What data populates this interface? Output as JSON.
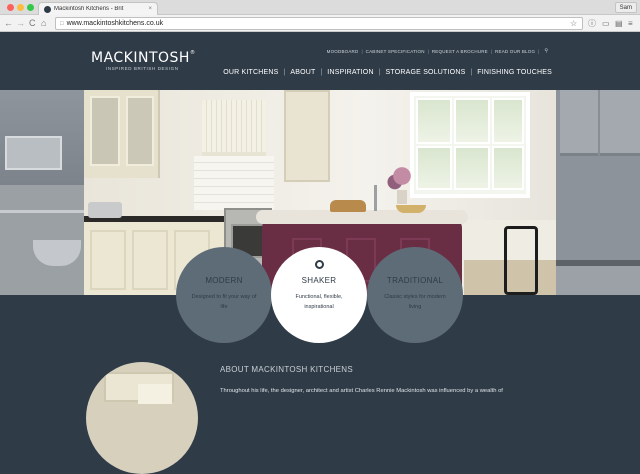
{
  "browser": {
    "tab_title": "Mackintosh Kitchens - Brit",
    "tab_close": "×",
    "user": "Sam",
    "url": "www.mackintoshkitchens.co.uk",
    "back": "←",
    "forward": "→",
    "reload": "C",
    "home": "⌂"
  },
  "header": {
    "logo": "MACKINTOSH",
    "logo_reg": "®",
    "tagline": "INSPIRED BRITISH DESIGN",
    "util_links": [
      "MOODBOARD",
      "CABINET SPECIFICATION",
      "REQUEST A BROCHURE",
      "READ OUR BLOG"
    ],
    "main_links": [
      "OUR KITCHENS",
      "ABOUT",
      "INSPIRATION",
      "STORAGE SOLUTIONS",
      "FINISHING TOUCHES"
    ]
  },
  "styles": [
    {
      "title": "MODERN",
      "desc": "Designed to fit your way of life"
    },
    {
      "title": "SHAKER",
      "desc": "Functional, flexible, inspirational"
    },
    {
      "title": "TRADITIONAL",
      "desc": "Classic styles for modern living"
    }
  ],
  "about": {
    "title": "ABOUT MACKINTOSH KITCHENS",
    "text": "Throughout his life, the designer, architect and artist Charles Rennie Mackintosh was influenced by a wealth of"
  },
  "colors": {
    "page_bg": "#2f3b47",
    "circle_bg": "#5e6c78",
    "circle_active": "#ffffff"
  }
}
